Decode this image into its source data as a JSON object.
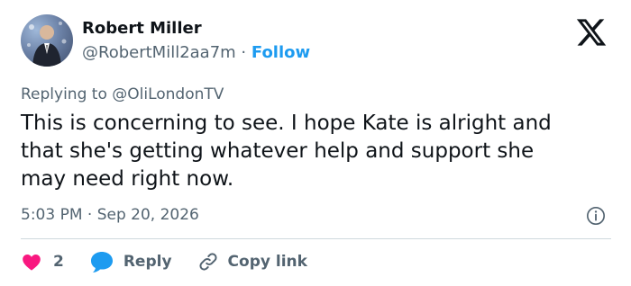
{
  "tweet": {
    "author_name": "Robert Miller",
    "handle": "@RobertMill2aa7m",
    "separator": " · ",
    "follow_label": "Follow",
    "replying_prefix": "Replying to ",
    "replying_mention": "@OliLondonTV",
    "text": "This is concerning to see. I hope Kate is alright and\nthat she's getting whatever help and support she\nmay need right now.",
    "timestamp": "5:03 PM · Sep 20, 2026",
    "like_count": "2",
    "reply_label": "Reply",
    "copy_link_label": "Copy link"
  },
  "icons": {
    "brand": "x-logo-icon",
    "info": "info-icon",
    "like": "heart-icon",
    "reply": "speech-bubble-icon",
    "copy": "link-icon"
  },
  "colors": {
    "accent": "#1d9bf0",
    "like": "#f91880",
    "text": "#0f1419",
    "muted": "#536471",
    "divider": "#cfd9de"
  }
}
